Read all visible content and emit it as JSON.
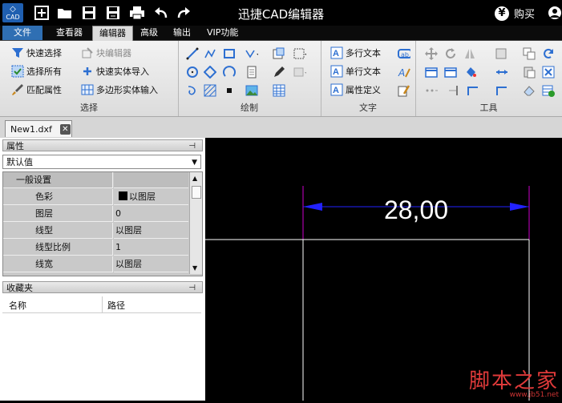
{
  "title_bar": {
    "logo_text": "CAD",
    "title": "迅捷CAD编辑器",
    "buy_label": "购买",
    "buy_icon": "¥"
  },
  "menu": {
    "tabs": [
      "文件",
      "查看器",
      "编辑器",
      "高级",
      "输出",
      "VIP功能"
    ],
    "active": "编辑器"
  },
  "ribbon": {
    "select_group": {
      "label": "选择",
      "quick_select": "快速选择",
      "select_all": "选择所有",
      "match_props": "匹配属性",
      "block_editor": "块编辑器",
      "quick_entity_import": "快速实体导入",
      "polygon_entity_input": "多边形实体输入"
    },
    "draw_group": {
      "label": "绘制"
    },
    "text_group": {
      "label": "文字",
      "multiline_text": "多行文本",
      "singleline_text": "单行文本",
      "attribute_def": "属性定义"
    },
    "tools_group": {
      "label": "工具"
    }
  },
  "document": {
    "tab_name": "New1.dxf",
    "close_glyph": "✕"
  },
  "properties_panel": {
    "title": "属性",
    "pin": "⊣",
    "selector_value": "默认值",
    "category": "一般设置",
    "rows": [
      {
        "key": "色彩",
        "value": "以图层",
        "swatch": "#000000"
      },
      {
        "key": "图层",
        "value": "0"
      },
      {
        "key": "线型",
        "value": "以图层"
      },
      {
        "key": "线型比例",
        "value": "1"
      },
      {
        "key": "线宽",
        "value": "以图层"
      }
    ]
  },
  "favorites_panel": {
    "title": "收藏夹",
    "col_name": "名称",
    "col_path": "路径"
  },
  "drawing": {
    "dimension_text": "28,00",
    "colors": {
      "dimension": "#2222ff",
      "ext_line": "#cc00cc",
      "geometry": "#ffffff"
    }
  },
  "watermark": {
    "line1": "脚本之家",
    "line2": "www.jb51.net"
  }
}
